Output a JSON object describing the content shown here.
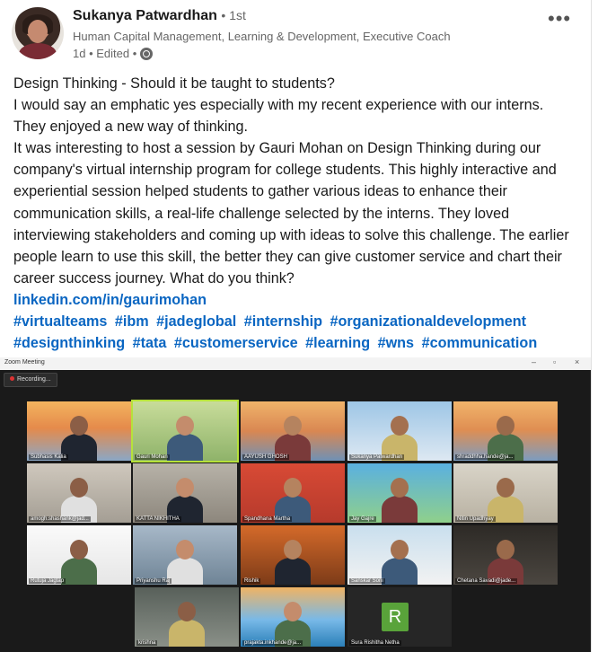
{
  "post": {
    "author": "Sukanya Patwardhan",
    "degree": "• 1st",
    "headline": "Human Capital Management, Learning & Development, Executive Coach",
    "time": "1d • Edited •",
    "more_label": "•••",
    "paragraphs": [
      "Design Thinking - Should it be taught to students?",
      "I would say an emphatic yes especially with my recent experience with our interns.",
      "They enjoyed a new way of thinking.",
      "It was interesting to host a session by Gauri Mohan on Design Thinking during our company's virtual internship program for college students. This highly interactive and experiential session helped students to gather various ideas to enhance their communication skills, a real-life challenge selected by the interns. They loved interviewing stakeholders and coming up with ideas to solve this challenge. The earlier people learn to use this skill, the better they can give customer service and chart their career success journey. What do you think?"
    ],
    "profile_link": "linkedin.com/in/gaurimohan",
    "hashtags_line1": [
      "#virtualteams",
      "#ibm",
      "#jadeglobal",
      "#internship",
      "#organizationaldevelopment"
    ],
    "hashtags_line2": [
      "#designthinking",
      "#tata",
      "#customerservice",
      "#learning",
      "#wns",
      "#communication"
    ]
  },
  "zoom": {
    "window_title": "Zoom Meeting",
    "recording_label": "Recording...",
    "participants": [
      "Subhasis Kalia",
      "Gauri Mohan",
      "AAYUSH GHOSH",
      "Sukanya Patwardhan",
      "shraddhha.hande@ja...",
      "amogh.shashank@jad...",
      "KATTA NIKHITHA",
      "Spandhana Martha",
      "Jay Gajre",
      "Nitin Upadhyay",
      "Rutuja Jagtap",
      "Priyanshu Raj",
      "Rishik",
      "Sanskar Soni",
      "Chetana Savadi@jade...",
      "krishna",
      "prajakta.inkhande@ja...",
      "Sura Rishitha Netha"
    ],
    "avatar_initial": "R",
    "colors": {
      "active_border": "#b6e23b",
      "avatar_green": "#59a33a",
      "link_blue": "#0a66c2"
    }
  }
}
